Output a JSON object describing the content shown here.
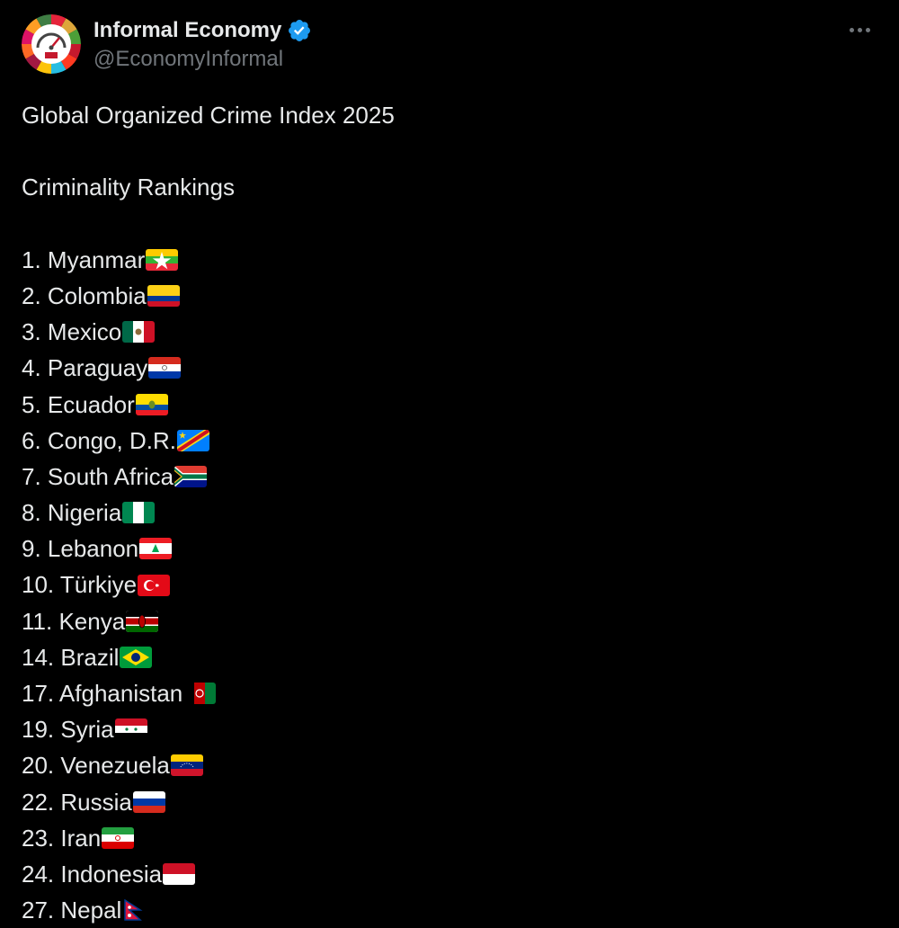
{
  "author": {
    "display_name": "Informal Economy",
    "handle": "@EconomyInformal",
    "verified": true,
    "avatar_icon": "gauge-wheel-logo-icon",
    "verified_icon": "verified-badge-icon"
  },
  "more_icon": "more-options-icon",
  "colors": {
    "background": "#000000",
    "text": "#e7e9ea",
    "secondary_text": "#71767b",
    "verified_blue": "#1d9bf0"
  },
  "tweet": {
    "title": "Global Organized Crime Index 2025",
    "subtitle": "Criminality Rankings",
    "rankings": [
      {
        "text": "1. Myanmar",
        "flag": "myanmar-flag-icon"
      },
      {
        "text": "2. Colombia",
        "flag": "colombia-flag-icon"
      },
      {
        "text": "3. Mexico",
        "flag": "mexico-flag-icon"
      },
      {
        "text": "4. Paraguay",
        "flag": "paraguay-flag-icon"
      },
      {
        "text": "5. Ecuador",
        "flag": "ecuador-flag-icon"
      },
      {
        "text": "6. Congo, D.R.",
        "flag": "dr-congo-flag-icon"
      },
      {
        "text": "7. South Africa",
        "flag": "south-africa-flag-icon"
      },
      {
        "text": "8. Nigeria",
        "flag": "nigeria-flag-icon"
      },
      {
        "text": "9. Lebanon",
        "flag": "lebanon-flag-icon"
      },
      {
        "text": "10. Türkiye",
        "flag": "turkiye-flag-icon"
      },
      {
        "text": "11. Kenya",
        "flag": "kenya-flag-icon"
      },
      {
        "text": "14. Brazil",
        "flag": "brazil-flag-icon"
      },
      {
        "text": "17. Afghanistan ",
        "flag": "afghanistan-flag-icon"
      },
      {
        "text": "19. Syria",
        "flag": "syria-flag-icon"
      },
      {
        "text": "20. Venezuela",
        "flag": "venezuela-flag-icon"
      },
      {
        "text": "22. Russia",
        "flag": "russia-flag-icon"
      },
      {
        "text": "23. Iran",
        "flag": "iran-flag-icon"
      },
      {
        "text": "24. Indonesia",
        "flag": "indonesia-flag-icon"
      },
      {
        "text": "27. Nepal",
        "flag": "nepal-flag-icon"
      }
    ]
  }
}
